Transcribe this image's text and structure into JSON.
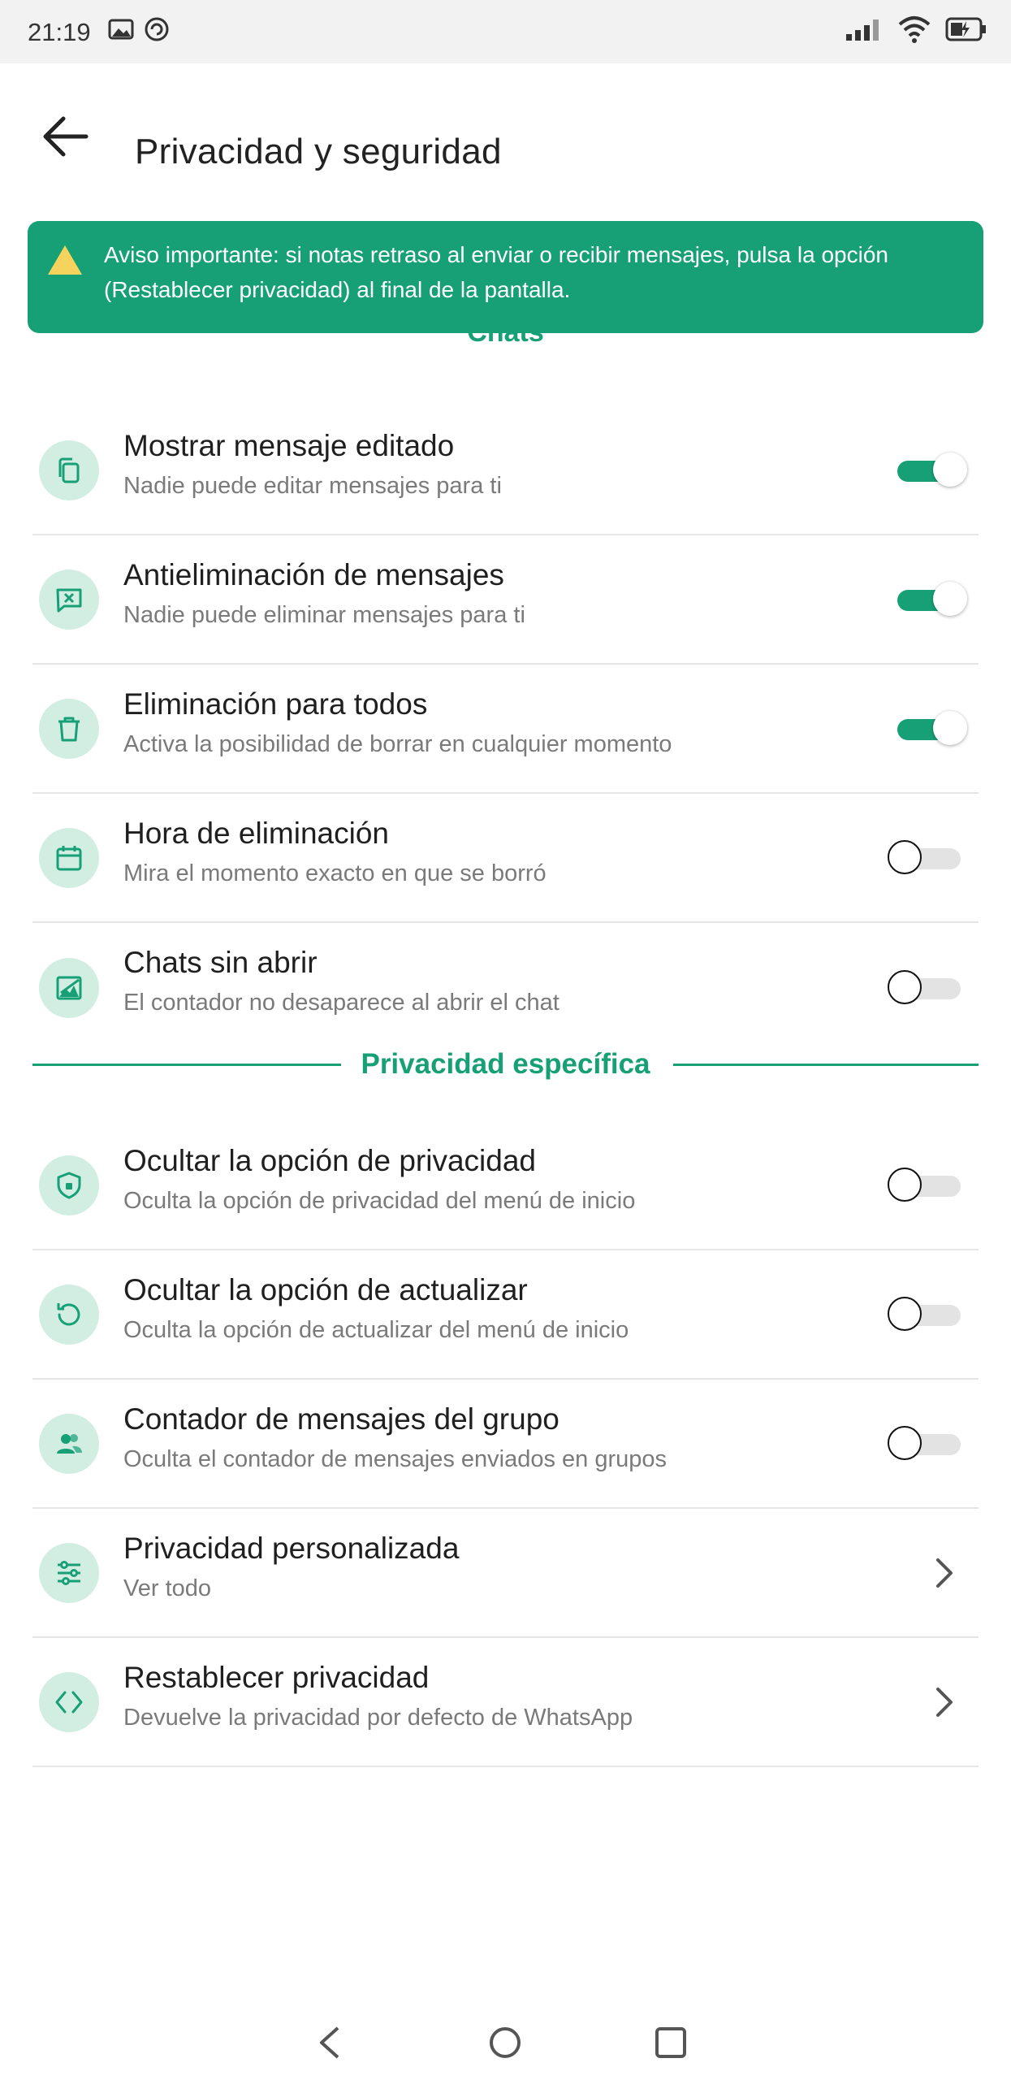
{
  "status_bar": {
    "time": "21:19",
    "icons": [
      "image-icon",
      "sync-icon",
      "signal-icon",
      "wifi-icon",
      "battery-icon"
    ]
  },
  "header": {
    "title": "Privacidad y seguridad",
    "back_icon": "arrow-left-icon"
  },
  "banner": {
    "text": "Aviso importante: si notas retraso al enviar o recibir mensajes, pulsa la opción (Restablecer privacidad) al final de la pantalla.",
    "icon": "warning-icon",
    "color": "#17a076"
  },
  "sections": {
    "chats_title": "Chats",
    "specific_title": "Privacidad específica"
  },
  "chats_items": [
    {
      "title": "Mostrar mensaje editado",
      "subtitle": "Nadie puede editar mensajes para ti",
      "icon": "copy-icon",
      "enabled": true
    },
    {
      "title": "Antieliminación de mensajes",
      "subtitle": "Nadie puede eliminar mensajes para ti",
      "icon": "message-x-icon",
      "enabled": true
    },
    {
      "title": "Eliminación para todos",
      "subtitle": "Activa la posibilidad de borrar en cualquier momento",
      "icon": "trash-icon",
      "enabled": true
    },
    {
      "title": "Hora de eliminación",
      "subtitle": "Mira el momento exacto en que se borró",
      "icon": "calendar-icon",
      "enabled": false
    },
    {
      "title": "Chats sin abrir",
      "subtitle": "El contador no desaparece al abrir el chat",
      "icon": "image-chart-icon",
      "enabled": false
    }
  ],
  "specific_items": [
    {
      "title": "Ocultar la opción de privacidad",
      "subtitle": "Oculta la opción de privacidad del menú de inicio",
      "icon": "shield-icon",
      "enabled": false
    },
    {
      "title": "Ocultar la opción de actualizar",
      "subtitle": "Oculta la opción de actualizar del menú de inicio",
      "icon": "refresh-icon",
      "enabled": false
    },
    {
      "title": "Contador de mensajes del grupo",
      "subtitle": "Oculta el contador de mensajes enviados en grupos",
      "icon": "group-icon",
      "enabled": false
    },
    {
      "title": "Privacidad personalizada",
      "subtitle": "Ver todo",
      "icon": "sliders-icon"
    },
    {
      "title": "Restablecer privacidad",
      "subtitle": "Devuelve la privacidad por defecto de WhatsApp",
      "icon": "code-icon"
    }
  ],
  "nav_bar": {
    "icons": [
      "nav-back-icon",
      "nav-home-icon",
      "nav-recents-icon"
    ]
  },
  "colors": {
    "accent": "#17a076",
    "icon_bg": "#d2eee3",
    "toggle_off_track": "#e3e3e3"
  }
}
